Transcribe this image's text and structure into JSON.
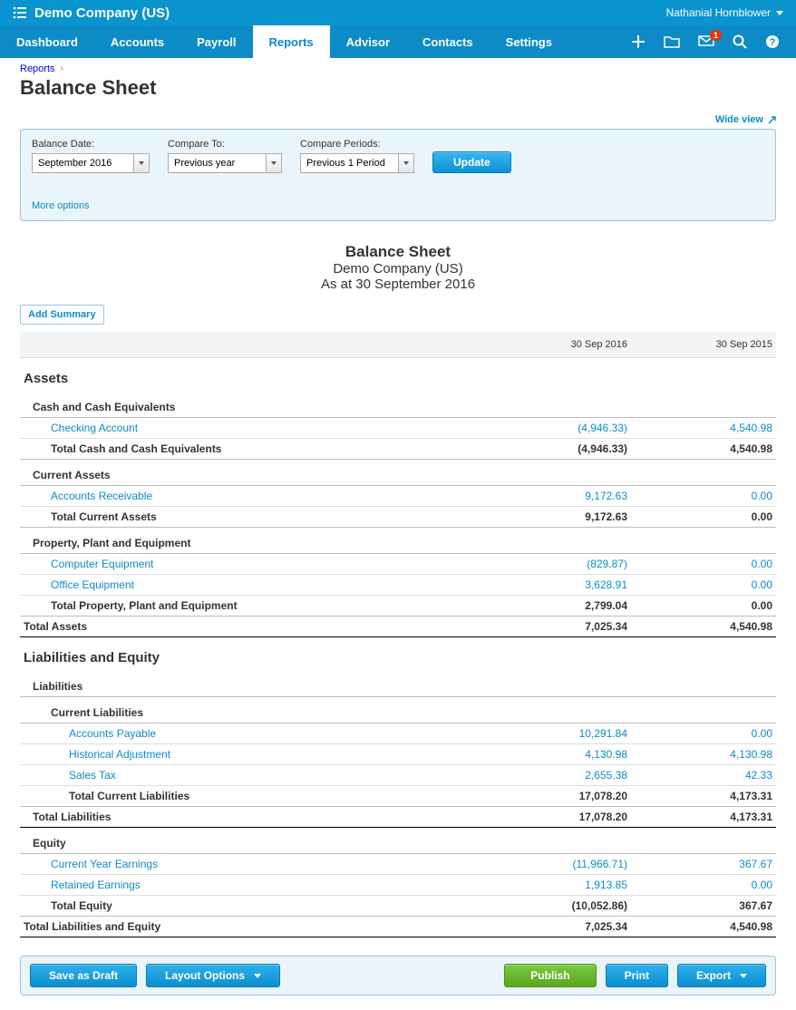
{
  "brand": {
    "company": "Demo Company (US)",
    "user": "Nathanial Hornblower"
  },
  "nav": {
    "items": [
      "Dashboard",
      "Accounts",
      "Payroll",
      "Reports",
      "Advisor",
      "Contacts",
      "Settings"
    ],
    "active_index": 3,
    "notification_count": "1"
  },
  "breadcrumb": {
    "root": "Reports"
  },
  "page": {
    "title": "Balance Sheet",
    "wide_view": "Wide view"
  },
  "filters": {
    "balance_date": {
      "label": "Balance Date:",
      "value": "September 2016"
    },
    "compare_to": {
      "label": "Compare To:",
      "value": "Previous year"
    },
    "compare_periods": {
      "label": "Compare Periods:",
      "value": "Previous 1 Period"
    },
    "update": "Update",
    "more_options": "More options"
  },
  "report": {
    "title": "Balance Sheet",
    "company": "Demo Company (US)",
    "as_at": "As at 30 September 2016",
    "add_summary": "Add Summary",
    "col1": "30 Sep 2016",
    "col2": "30 Sep 2015"
  },
  "assets": {
    "heading": "Assets",
    "cash_group": "Cash and Cash Equivalents",
    "checking": {
      "label": "Checking Account",
      "v1": "(4,946.33)",
      "v2": "4,540.98"
    },
    "cash_total": {
      "label": "Total Cash and Cash Equivalents",
      "v1": "(4,946.33)",
      "v2": "4,540.98"
    },
    "current_group": "Current Assets",
    "ar": {
      "label": "Accounts Receivable",
      "v1": "9,172.63",
      "v2": "0.00"
    },
    "current_total": {
      "label": "Total Current Assets",
      "v1": "9,172.63",
      "v2": "0.00"
    },
    "ppe_group": "Property, Plant and Equipment",
    "comp_equip": {
      "label": "Computer Equipment",
      "v1": "(829.87)",
      "v2": "0.00"
    },
    "office_equip": {
      "label": "Office Equipment",
      "v1": "3,628.91",
      "v2": "0.00"
    },
    "ppe_total": {
      "label": "Total Property, Plant and Equipment",
      "v1": "2,799.04",
      "v2": "0.00"
    },
    "total": {
      "label": "Total Assets",
      "v1": "7,025.34",
      "v2": "4,540.98"
    }
  },
  "liab_equity": {
    "heading": "Liabilities and Equity",
    "liab_group": "Liabilities",
    "cur_liab_group": "Current Liabilities",
    "ap": {
      "label": "Accounts Payable",
      "v1": "10,291.84",
      "v2": "0.00"
    },
    "hist": {
      "label": "Historical Adjustment",
      "v1": "4,130.98",
      "v2": "4,130.98"
    },
    "sales_tax": {
      "label": "Sales Tax",
      "v1": "2,655.38",
      "v2": "42.33"
    },
    "cur_liab_total": {
      "label": "Total Current Liabilities",
      "v1": "17,078.20",
      "v2": "4,173.31"
    },
    "liab_total": {
      "label": "Total Liabilities",
      "v1": "17,078.20",
      "v2": "4,173.31"
    },
    "equity_group": "Equity",
    "cye": {
      "label": "Current Year Earnings",
      "v1": "(11,966.71)",
      "v2": "367.67"
    },
    "re": {
      "label": "Retained Earnings",
      "v1": "1,913.85",
      "v2": "0.00"
    },
    "equity_total": {
      "label": "Total Equity",
      "v1": "(10,052.86)",
      "v2": "367.67"
    },
    "total": {
      "label": "Total Liabilities and Equity",
      "v1": "7,025.34",
      "v2": "4,540.98"
    }
  },
  "actions": {
    "save_draft": "Save as Draft",
    "layout_options": "Layout Options",
    "publish": "Publish",
    "print": "Print",
    "export": "Export"
  }
}
